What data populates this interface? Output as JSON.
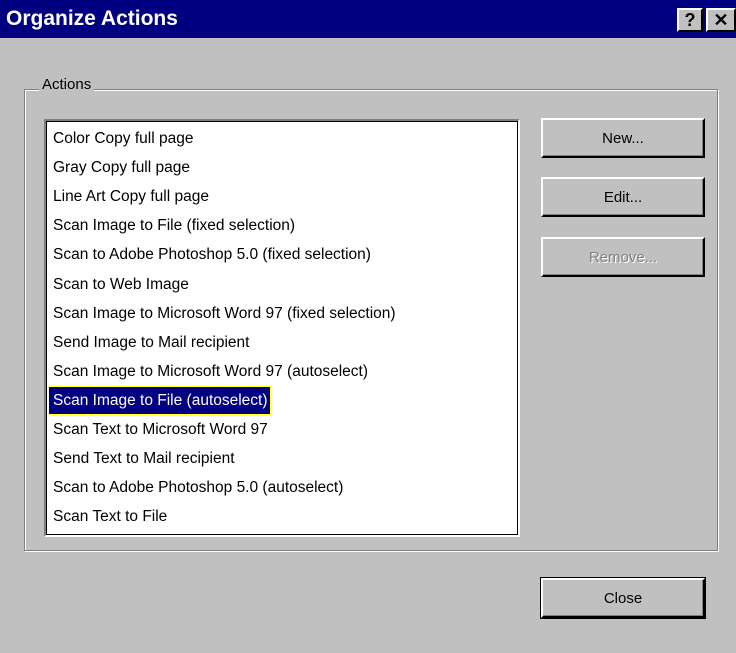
{
  "window": {
    "title": "Organize Actions",
    "help_label": "?",
    "close_label": "✕"
  },
  "group": {
    "label": "Actions"
  },
  "actions": {
    "items": [
      "Color Copy full page",
      "Gray Copy full page",
      "Line Art Copy full page",
      "Scan Image to File (fixed selection)",
      "Scan to Adobe Photoshop 5.0 (fixed selection)",
      "Scan to Web Image",
      "Scan Image to Microsoft Word 97 (fixed selection)",
      "Send Image to Mail recipient",
      "Scan Image to Microsoft Word 97 (autoselect)",
      "Scan Image to File (autoselect)",
      "Scan Text to Microsoft Word 97",
      "Send Text to Mail recipient",
      "Scan to Adobe Photoshop 5.0 (autoselect)",
      "Scan Text to File"
    ],
    "selected_index": 9
  },
  "buttons": {
    "new_label": "New...",
    "edit_label": "Edit...",
    "remove_label": "Remove...",
    "close_label": "Close"
  },
  "colors": {
    "titlebar": "#000080",
    "face": "#c0c0c0",
    "selection": "#000080"
  }
}
